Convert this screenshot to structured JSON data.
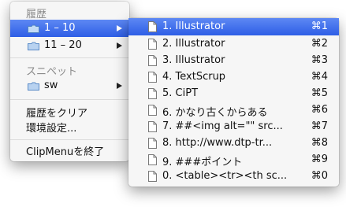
{
  "main_menu": {
    "history_header": "履歴",
    "history_items": [
      {
        "label": "1 – 10"
      },
      {
        "label": "11 – 20"
      }
    ],
    "snippets_header": "スニペット",
    "snippet_items": [
      {
        "label": "sw"
      }
    ],
    "clear_history": "履歴をクリア",
    "preferences": "環境設定...",
    "quit": "ClipMenuを終了"
  },
  "submenu": {
    "items": [
      {
        "label": "1. Illustrator",
        "shortcut": "⌘1"
      },
      {
        "label": "2. Illustrator",
        "shortcut": "⌘2"
      },
      {
        "label": "3. Illustrator",
        "shortcut": "⌘3"
      },
      {
        "label": "4. TextScrup",
        "shortcut": "⌘4"
      },
      {
        "label": "5. CiPT",
        "shortcut": "⌘5"
      },
      {
        "label": "6. かなり古くからある",
        "shortcut": "⌘6"
      },
      {
        "label": "7. ##<img alt=\"\" src...",
        "shortcut": "⌘7"
      },
      {
        "label": "8. http://www.dtp-tr...",
        "shortcut": "⌘8"
      },
      {
        "label": "9. ###ポイント",
        "shortcut": "⌘9"
      },
      {
        "label": "0. <table><tr><th sc...",
        "shortcut": "⌘0"
      }
    ]
  }
}
